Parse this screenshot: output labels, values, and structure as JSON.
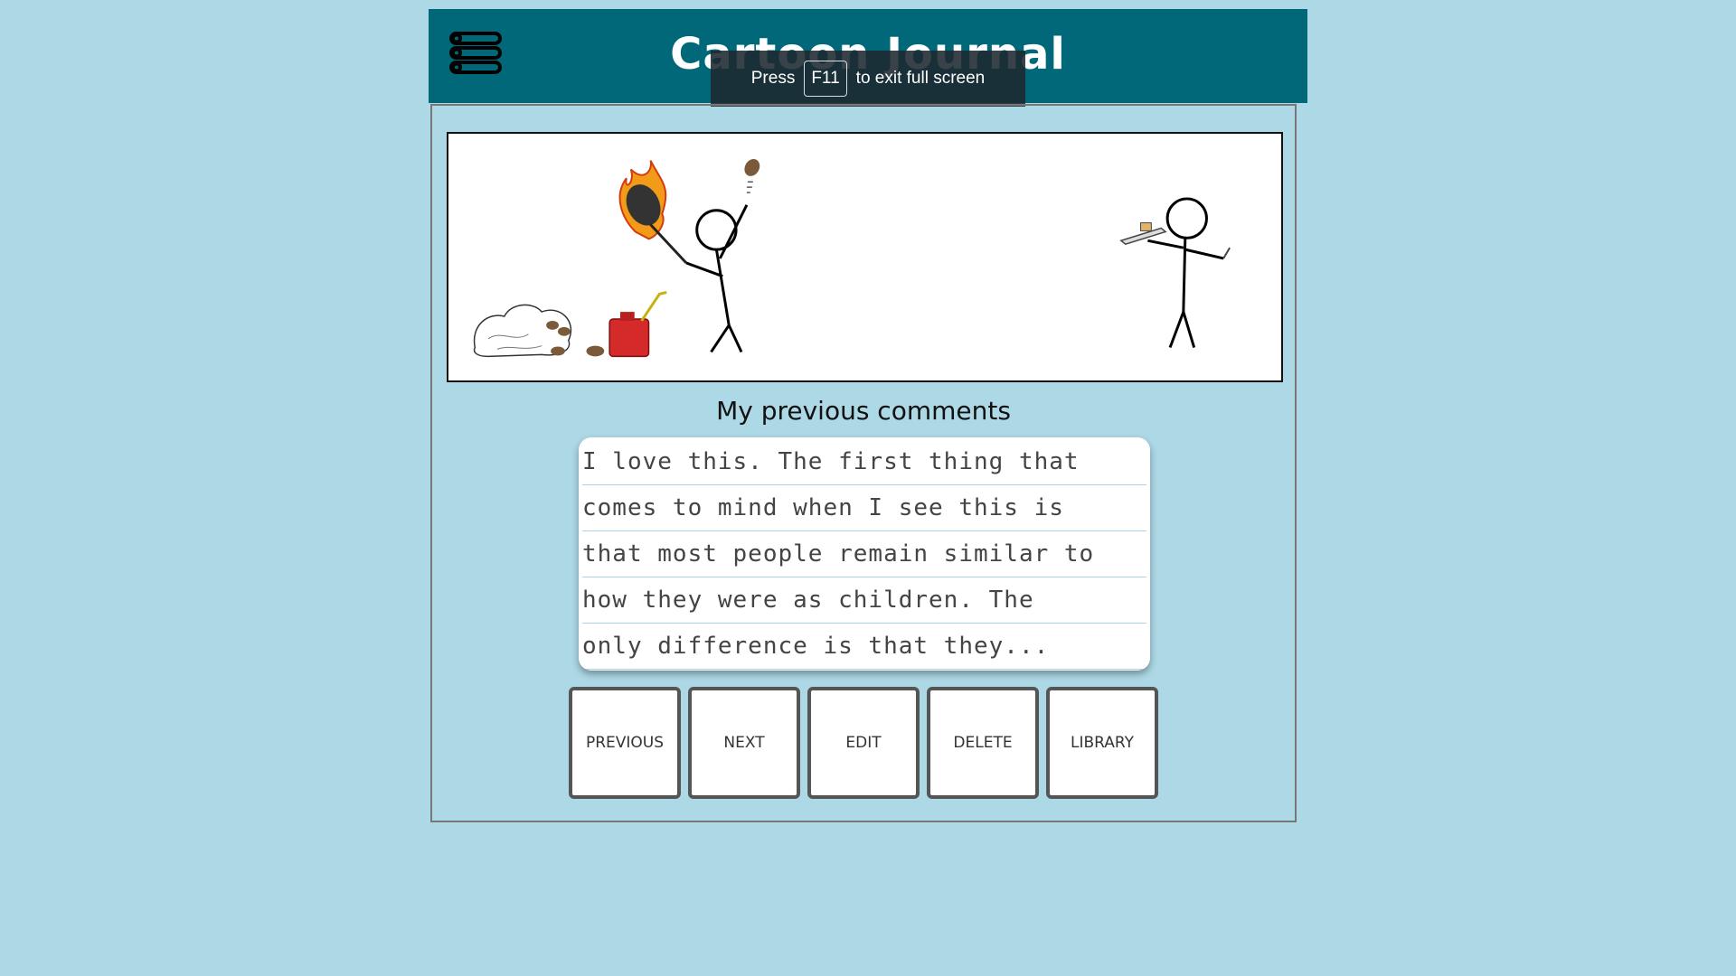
{
  "header": {
    "title": "Cartoon Journal",
    "menu_icon": "hamburger-list-icon"
  },
  "fullscreen_notice": {
    "press": "Press",
    "key": "F11",
    "message": "to exit full screen"
  },
  "comic": {
    "description_icon": "comic-strip-image"
  },
  "comments": {
    "heading": "My previous comments",
    "lines": [
      "I love this. The first thing that",
      "comes to mind when I see this is",
      "that most people remain similar to",
      "how they were as children. The",
      "only difference is that they..."
    ]
  },
  "buttons": {
    "previous": "PREVIOUS",
    "next": "NEXT",
    "edit": "EDIT",
    "delete": "DELETE",
    "library": "LIBRARY"
  },
  "colors": {
    "background": "#add8e6",
    "header": "#006878"
  }
}
